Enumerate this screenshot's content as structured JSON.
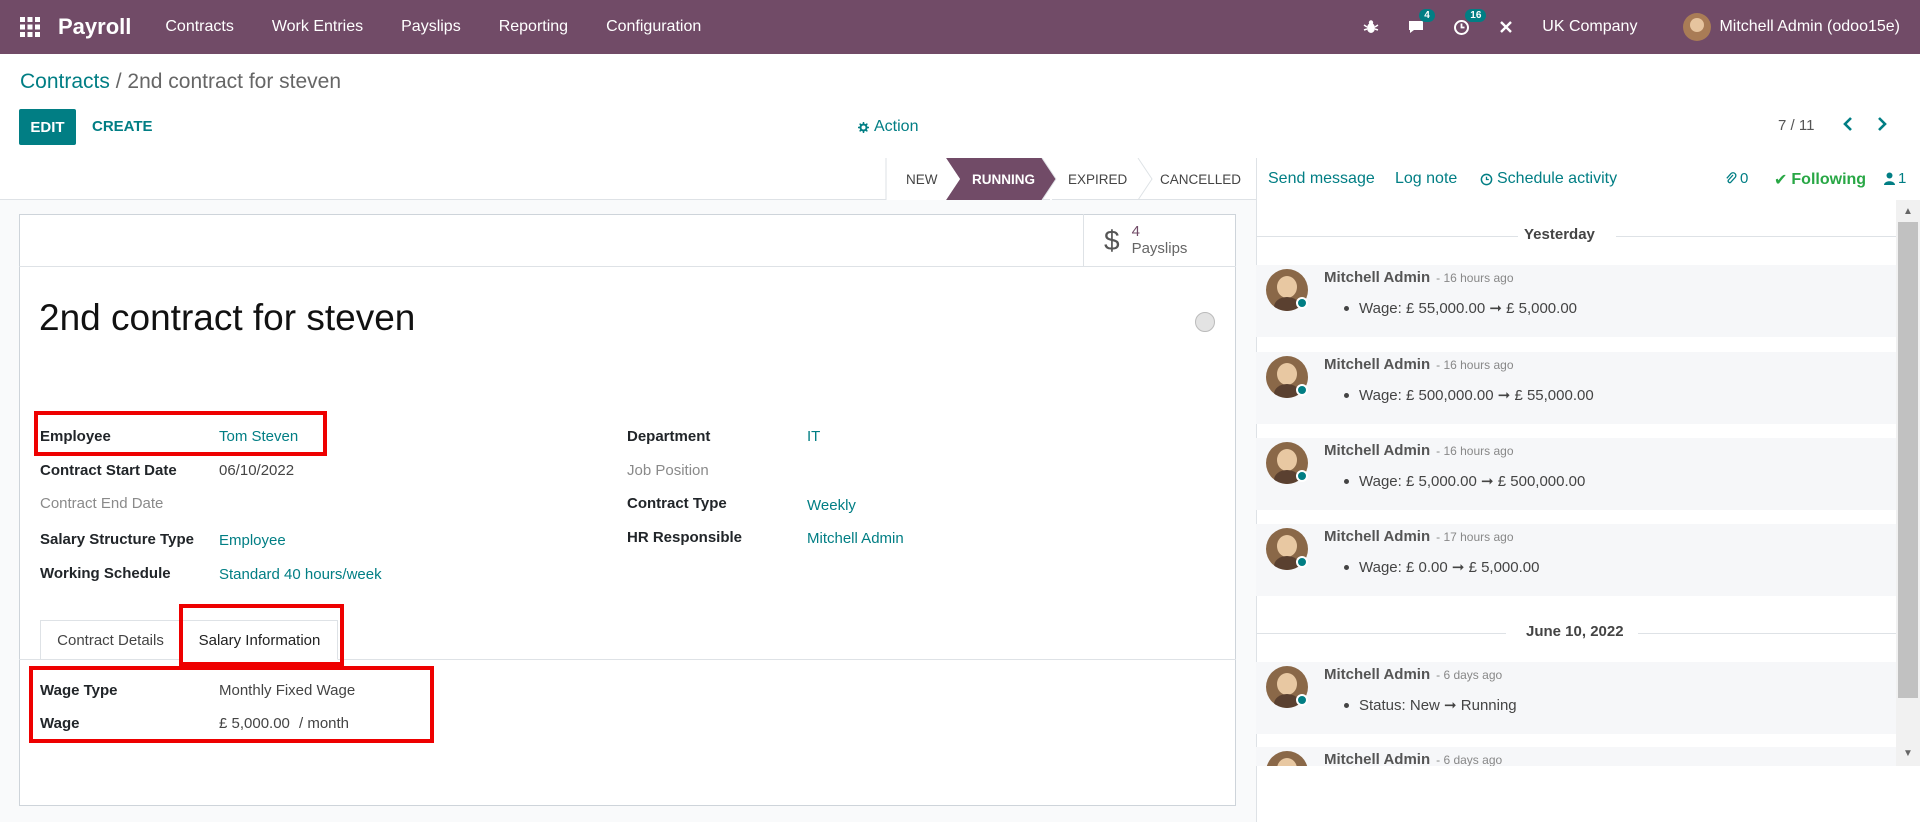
{
  "navbar": {
    "brand": "Payroll",
    "menus": [
      "Contracts",
      "Work Entries",
      "Payslips",
      "Reporting",
      "Configuration"
    ],
    "chat_badge": "4",
    "activity_badge": "16",
    "company": "UK Company",
    "user": "Mitchell Admin (odoo15e)"
  },
  "breadcrumb": {
    "parent": "Contracts",
    "separator": "/",
    "current": "2nd contract for steven"
  },
  "controls": {
    "edit": "EDIT",
    "create": "CREATE",
    "action": "Action",
    "pager": "7 / 11"
  },
  "statusbar": {
    "stages": [
      "NEW",
      "RUNNING",
      "EXPIRED",
      "CANCELLED"
    ],
    "active": "RUNNING"
  },
  "smart_button": {
    "value": "4",
    "label": "Payslips"
  },
  "record": {
    "title": "2nd contract for steven"
  },
  "fields_left": [
    {
      "label": "Employee",
      "value": "Tom Steven"
    },
    {
      "label": "Contract Start Date",
      "value": "06/10/2022"
    },
    {
      "label": "Contract End Date",
      "value": ""
    },
    {
      "label": "Salary Structure Type",
      "value": "Employee"
    },
    {
      "label": "Working Schedule",
      "value": "Standard 40 hours/week"
    }
  ],
  "fields_right": [
    {
      "label": "Department",
      "value": "IT"
    },
    {
      "label": "Job Position",
      "value": ""
    },
    {
      "label": "Contract Type",
      "value": "Weekly"
    },
    {
      "label": "HR Responsible",
      "value": "Mitchell Admin"
    }
  ],
  "tabs": [
    "Contract Details",
    "Salary Information"
  ],
  "salary": {
    "wage_type_label": "Wage Type",
    "wage_type": "Monthly Fixed Wage",
    "wage_label": "Wage",
    "wage": "£ 5,000.00",
    "wage_unit": "/ month"
  },
  "chatter": {
    "send_message": "Send message",
    "log_note": "Log note",
    "schedule_activity": "Schedule activity",
    "attachments": "0",
    "following": "Following",
    "followers": "1",
    "days": [
      "Yesterday",
      "June 10, 2022"
    ],
    "messages": [
      {
        "author": "Mitchell Admin",
        "date": "- 16 hours ago",
        "body": "Wage: £ 55,000.00 ➞ £ 5,000.00"
      },
      {
        "author": "Mitchell Admin",
        "date": "- 16 hours ago",
        "body": "Wage: £ 500,000.00 ➞ £ 55,000.00"
      },
      {
        "author": "Mitchell Admin",
        "date": "- 16 hours ago",
        "body": "Wage: £ 5,000.00 ➞ £ 500,000.00"
      },
      {
        "author": "Mitchell Admin",
        "date": "- 17 hours ago",
        "body": "Wage: £ 0.00 ➞ £ 5,000.00"
      },
      {
        "author": "Mitchell Admin",
        "date": "- 6 days ago",
        "body": "Status: New ➞ Running"
      },
      {
        "author": "Mitchell Admin",
        "date": "- 6 days ago",
        "body": ""
      }
    ]
  },
  "colors": {
    "brand": "#714b67",
    "accent": "#017e84",
    "highlight": "#ee0000",
    "following": "#28a745"
  }
}
